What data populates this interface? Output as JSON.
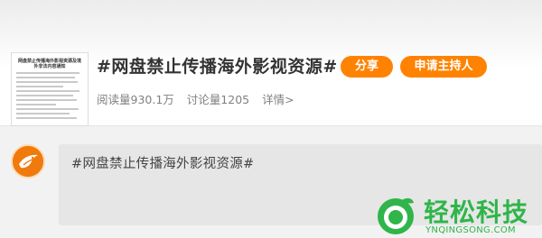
{
  "topic": {
    "title": "#网盘禁止传播海外影视资源#",
    "share_label": "分享",
    "apply_host_label": "申请主持人",
    "read_count": "阅读量930.1万",
    "discussion_count": "讨论量1205",
    "details_label": "详情>"
  },
  "thumbnail": {
    "title": "网盘禁止传播海外影视资源及境外非法内容通知"
  },
  "composer": {
    "text": "#网盘禁止传播海外影视资源#",
    "avatar_icon": "weibo-bird-icon"
  },
  "watermark": {
    "text": "轻松科技",
    "url": "YNQINGSONG.COM",
    "logo_icon": "green-leaf-o-icon",
    "color": "#2fb54a"
  },
  "colors": {
    "accent": "#ff8200"
  }
}
